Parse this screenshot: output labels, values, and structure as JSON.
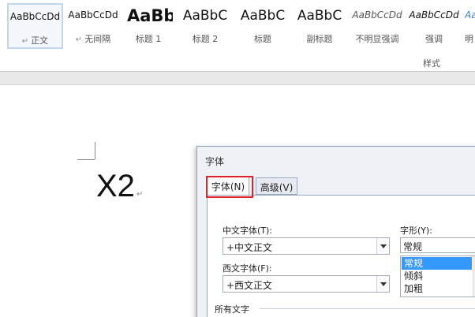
{
  "ribbon": {
    "styles": [
      {
        "preview": "AaBbCcDd",
        "label": "正文",
        "para_mark": "↵",
        "selected": true
      },
      {
        "preview": "AaBbCcDd",
        "label": "无间隔",
        "para_mark": "↵"
      },
      {
        "preview": "AaBb",
        "label": "标题 1"
      },
      {
        "preview": "AaBbC",
        "label": "标题 2"
      },
      {
        "preview": "AaBbC",
        "label": "标题"
      },
      {
        "preview": "AaBbC",
        "label": "副标题"
      },
      {
        "preview": "AaBbCcDd",
        "label": "不明显强调"
      },
      {
        "preview": "AaBbCcDd",
        "label": "强调"
      },
      {
        "preview": "Aa",
        "label": "明"
      }
    ],
    "group_label": "样式"
  },
  "document": {
    "text": "X2",
    "para_mark": "↵"
  },
  "font_dialog": {
    "title": "字体",
    "tabs": [
      {
        "label": "字体(N)",
        "active": true
      },
      {
        "label": "高级(V)",
        "active": false
      }
    ],
    "chinese_font": {
      "label": "中文字体(T):",
      "value": "+中文正文"
    },
    "western_font": {
      "label": "西文字体(F):",
      "value": "+西文正文"
    },
    "font_style": {
      "label": "字形(Y):",
      "value": "常规",
      "options": [
        "常规",
        "倾斜",
        "加粗"
      ],
      "selected": "常规"
    },
    "all_text_section": "所有文字"
  },
  "colors": {
    "highlight_red": "#e0232a",
    "selection_blue": "#3399ff"
  }
}
